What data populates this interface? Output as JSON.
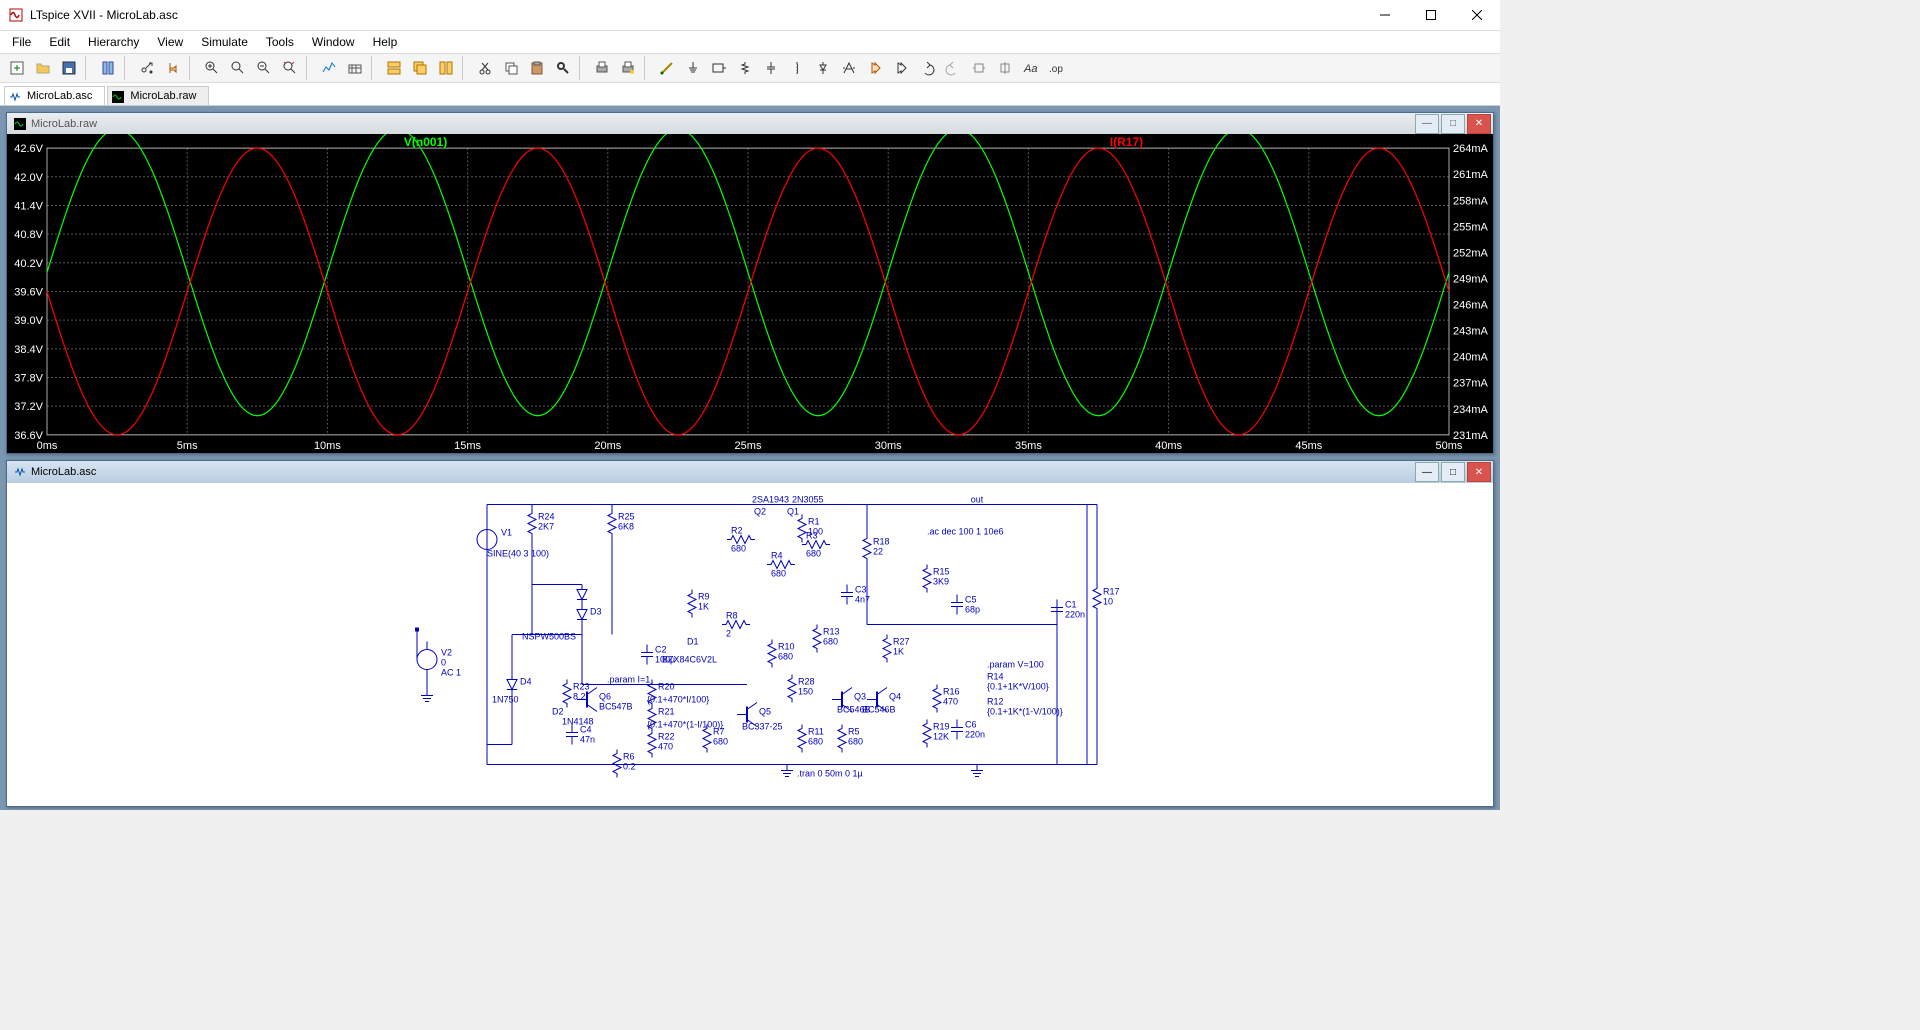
{
  "title": "LTspice XVII - MicroLab.asc",
  "menus": [
    "File",
    "Edit",
    "Hierarchy",
    "View",
    "Simulate",
    "Tools",
    "Window",
    "Help"
  ],
  "tabs": [
    {
      "label": "MicroLab.asc",
      "icon": "schem"
    },
    {
      "label": "MicroLab.raw",
      "icon": "wave"
    }
  ],
  "childwins": [
    {
      "title": "MicroLab.raw",
      "active": false
    },
    {
      "title": "MicroLab.asc",
      "active": true
    }
  ],
  "chart_data": {
    "type": "line",
    "title": "",
    "xlabel": "",
    "ylabel_left": "",
    "ylabel_right": "",
    "x_ticks": [
      "0ms",
      "5ms",
      "10ms",
      "15ms",
      "20ms",
      "25ms",
      "30ms",
      "35ms",
      "40ms",
      "45ms",
      "50ms"
    ],
    "y_left_ticks": [
      "36.6V",
      "37.2V",
      "37.8V",
      "38.4V",
      "39.0V",
      "39.6V",
      "40.2V",
      "40.8V",
      "41.4V",
      "42.0V",
      "42.6V"
    ],
    "y_right_ticks": [
      "231mA",
      "234mA",
      "237mA",
      "240mA",
      "243mA",
      "246mA",
      "249mA",
      "252mA",
      "255mA",
      "258mA",
      "261mA",
      "264mA"
    ],
    "xlim": [
      0,
      50
    ],
    "ylim_left": [
      36.6,
      42.6
    ],
    "ylim_right": [
      231,
      264
    ],
    "series": [
      {
        "name": "V(n001)",
        "color": "#00ff00",
        "axis": "left",
        "amplitude": 3.0,
        "offset": 40.0,
        "freq_hz": 100,
        "phase_deg": 0
      },
      {
        "name": "I(R17)",
        "color": "#ff0000",
        "axis": "right",
        "amplitude": 16.5,
        "offset": 247.5,
        "freq_hz": 100,
        "phase_deg": 180
      }
    ]
  },
  "schematic_text": {
    "out": "out",
    "ac": ".ac dec 100 1 10e6",
    "param_v": ".param V=100",
    "param_i": ".param I=1",
    "tran": ".tran 0 50m 0 1µ",
    "V1": "V1",
    "V1v": "SINE(40 3 100)",
    "V2": "V2",
    "V2v": "0",
    "V2ac": "AC 1",
    "R24": "R24",
    "R24v": "2K7",
    "R25": "R25",
    "R25v": "6K8",
    "R18": "R18",
    "R18v": "22",
    "R15": "R15",
    "R15v": "3K9",
    "C5": "C5",
    "C5v": "68p",
    "R17": "R17",
    "R17v": "10",
    "C1": "C1",
    "C1v": "220n",
    "R1": "R1",
    "R1v": "100",
    "R2": "R2",
    "R2v": "680",
    "R3": "R3",
    "R3v": "680",
    "R4": "R4",
    "R4v": "680",
    "C3": "C3",
    "C3v": "4n7",
    "R9": "R9",
    "R9v": "1K",
    "R8": "R8",
    "R8v": "2",
    "R10": "R10",
    "R10v": "680",
    "R13": "R13",
    "R13v": "680",
    "R27": "R27",
    "R27v": "1K",
    "R28": "R28",
    "R28v": "150",
    "C2": "C2",
    "C2v": "100µ",
    "D1": "D1",
    "D1v": "BZX84C6V2L",
    "D3": "D3",
    "D3v": "NSPW500BS",
    "D4": "D4",
    "D4v": "1N750",
    "D2": "D2",
    "D2v": "1N4148",
    "R23": "R23",
    "R23v": "8.2",
    "Q6": "Q6",
    "Q6v": "BC547B",
    "C4": "C4",
    "C4v": "47n",
    "R6": "R6",
    "R6v": "0.2",
    "R20": "R20",
    "R20v": "{0.1+470*I/100}",
    "R21": "R21",
    "R21v": "{0.1+470*(1-I/100)}",
    "R22": "R22",
    "R22v": "470",
    "Q5": "Q5",
    "Q5v": "BC337-25",
    "R7": "R7",
    "R7v": "680",
    "R11": "R11",
    "R11v": "680",
    "R5": "R5",
    "R5v": "680",
    "Q3": "Q3",
    "Q4": "Q4",
    "Q3v": "BC546B",
    "Q4v": "BC546B",
    "Q1": "Q1",
    "Q1v": "2N3055",
    "Q2": "Q2",
    "Q2v": "2SA1943",
    "R16": "R16",
    "R16v": "470",
    "R19": "R19",
    "R19v": "12K",
    "C6": "C6",
    "C6v": "220n",
    "R14": "R14",
    "R14v": "{0.1+1K*V/100}",
    "R12": "R12",
    "R12v": "{0.1+1K*(1-V/100)}"
  }
}
